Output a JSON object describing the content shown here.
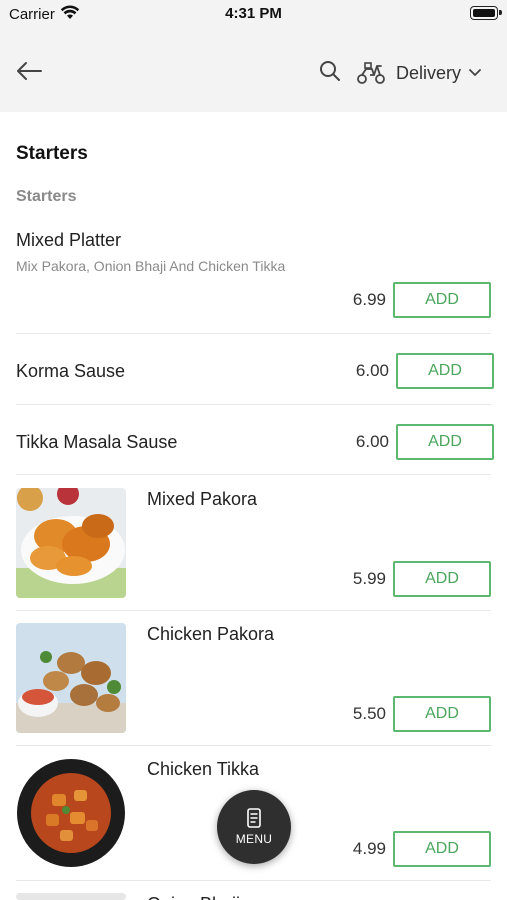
{
  "status_bar": {
    "carrier": "Carrier",
    "time": "4:31 PM"
  },
  "header": {
    "delivery_label": "Delivery"
  },
  "menu": {
    "section_title": "Starters",
    "subsection_title": "Starters",
    "items": [
      {
        "name": "Mixed Platter",
        "description": "Mix Pakora, Onion Bhaji And Chicken Tikka",
        "price": "6.99",
        "action": "ADD"
      },
      {
        "name": "Korma Sause",
        "price": "6.00",
        "action": "ADD"
      },
      {
        "name": "Tikka Masala Sause",
        "price": "6.00",
        "action": "ADD"
      },
      {
        "name": "Mixed Pakora",
        "price": "5.99",
        "action": "ADD"
      },
      {
        "name": "Chicken Pakora",
        "price": "5.50",
        "action": "ADD"
      },
      {
        "name": "Chicken Tikka",
        "price": "4.99",
        "action": "ADD"
      },
      {
        "name": "Onion Bhaji"
      }
    ]
  },
  "fab": {
    "label": "MENU"
  },
  "colors": {
    "accent_green": "#5cb86e",
    "header_bg": "#f3f3f3",
    "fab_bg": "#2f2f2f"
  }
}
